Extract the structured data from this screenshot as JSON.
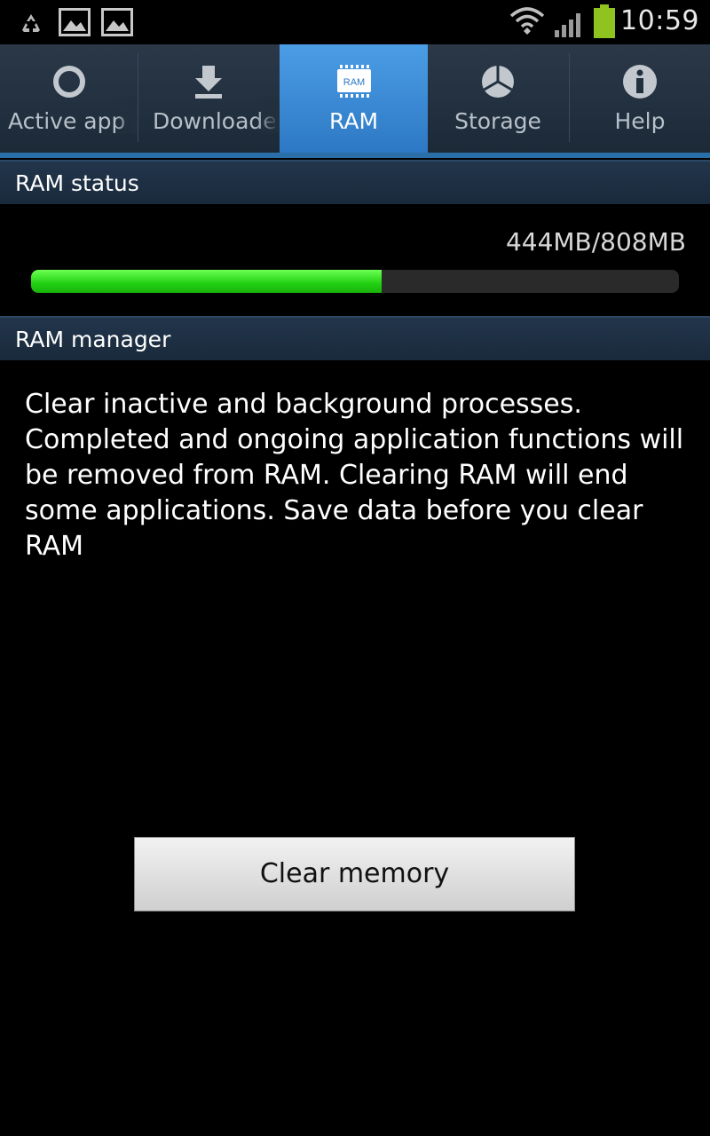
{
  "status_bar": {
    "time": "10:59",
    "icons": [
      "recycle-icon",
      "picture-icon",
      "picture-icon",
      "wifi-icon",
      "signal-icon",
      "battery-icon"
    ]
  },
  "tabs": [
    {
      "label": "Active app",
      "icon": "circle-ring-icon",
      "selected": false
    },
    {
      "label": "Downloaded",
      "icon": "download-arrow-icon",
      "selected": false
    },
    {
      "label": "RAM",
      "icon": "ram-chip-icon",
      "selected": true
    },
    {
      "label": "Storage",
      "icon": "pie-chart-icon",
      "selected": false
    },
    {
      "label": "Help",
      "icon": "info-icon",
      "selected": false
    }
  ],
  "ram_chip_text": "RAM",
  "ram_status": {
    "header": "RAM status",
    "value": "444MB/808MB",
    "used_fraction": 0.5405
  },
  "ram_manager": {
    "header": "RAM manager",
    "description": "Clear inactive and background processes. Completed and ongoing application functions will be removed from RAM. Clearing RAM will end some applications. Save data before you clear RAM"
  },
  "clear_button_label": "Clear memory",
  "colors": {
    "selected_tab": "#3f8fd8",
    "progress_fill": "#22d312",
    "header_bg": "#1e2f42"
  }
}
